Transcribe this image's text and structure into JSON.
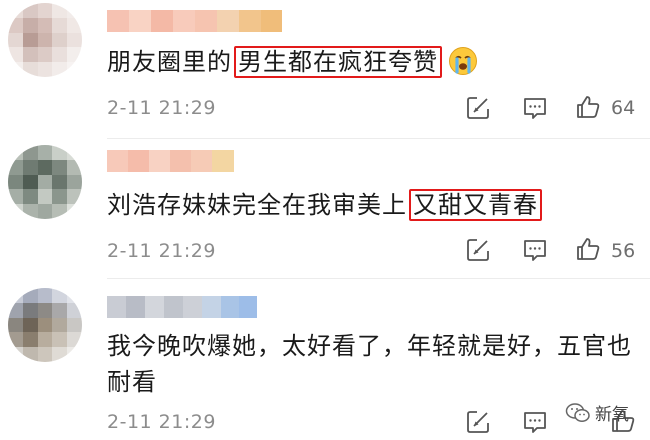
{
  "comments": [
    {
      "text_before": "朋友圈里的",
      "highlight": "男生都在疯狂夸赞",
      "text_after": "",
      "emoji": "crying-face-icon",
      "time": "2-11 21:29",
      "likes": "64"
    },
    {
      "text_before": "刘浩存妹妹完全在我审美上",
      "highlight": "又甜又青春",
      "text_after": "",
      "time": "2-11 21:29",
      "likes": "56"
    },
    {
      "line1": "我今晚吹爆她，太好看了，年轻就是好，五官也",
      "line2": "耐看",
      "time": "2-11 21:29",
      "likes": ""
    }
  ],
  "watermark": {
    "text": "新氧",
    "icon": "wechat-icon"
  },
  "colors": {
    "highlight_border": "#e21a1a",
    "meta_text": "#8c8c8c"
  }
}
